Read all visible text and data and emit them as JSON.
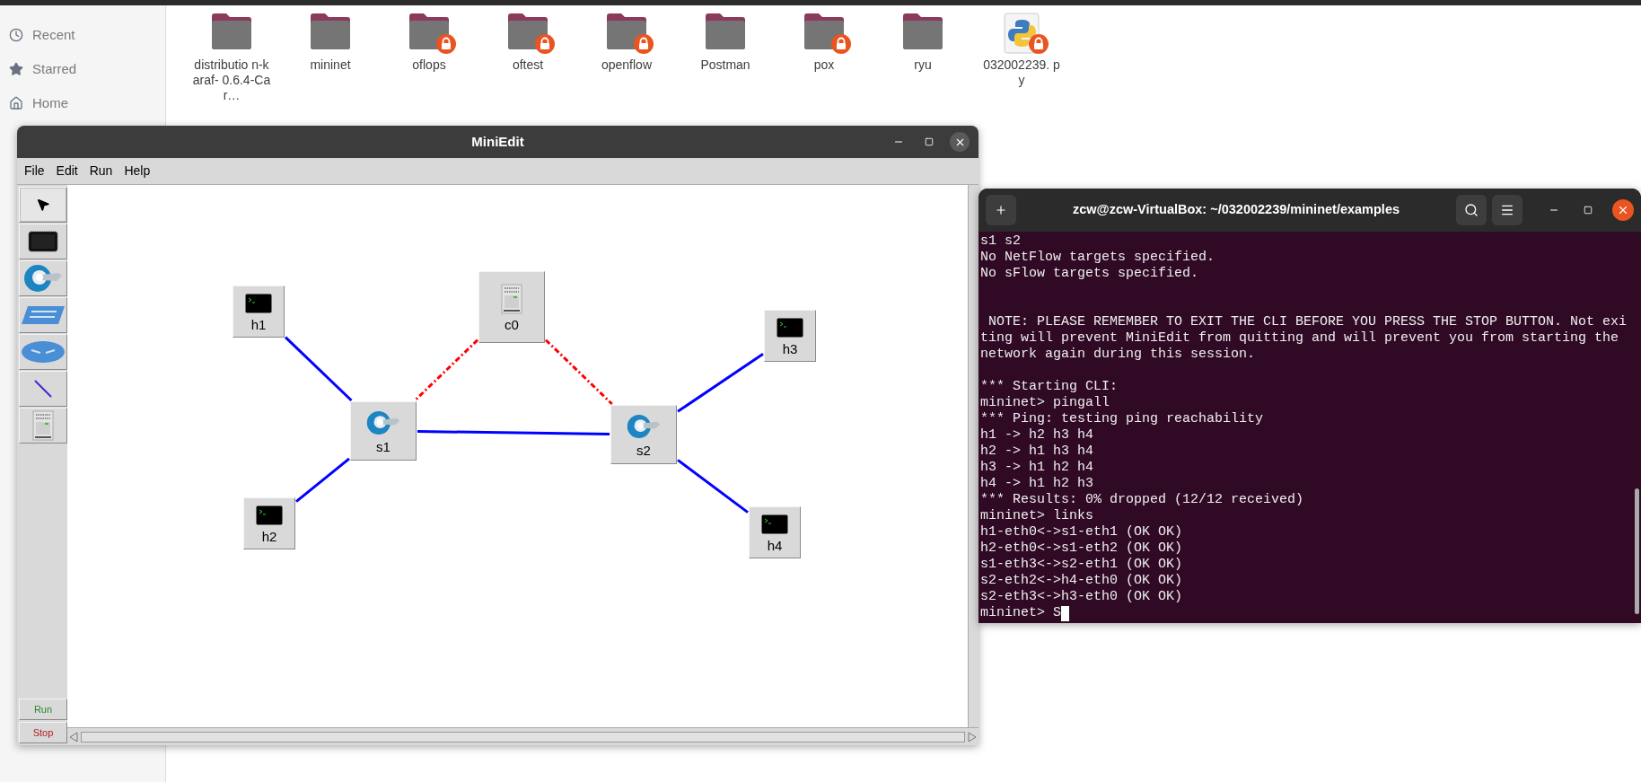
{
  "file_manager": {
    "sidebar": [
      {
        "label": "Recent",
        "kind": "clock"
      },
      {
        "label": "Starred",
        "kind": "star"
      },
      {
        "label": "Home",
        "kind": "home"
      }
    ],
    "files": [
      {
        "name": "distributio n-karaf- 0.6.4-Car…",
        "kind": "folder",
        "locked": false
      },
      {
        "name": "mininet",
        "kind": "folder",
        "locked": false
      },
      {
        "name": "oflops",
        "kind": "folder",
        "locked": true
      },
      {
        "name": "oftest",
        "kind": "folder",
        "locked": true
      },
      {
        "name": "openflow",
        "kind": "folder",
        "locked": true
      },
      {
        "name": "Postman",
        "kind": "folder",
        "locked": false
      },
      {
        "name": "pox",
        "kind": "folder",
        "locked": true
      },
      {
        "name": "ryu",
        "kind": "folder",
        "locked": false
      },
      {
        "name": "032002239. py",
        "kind": "python",
        "locked": true
      }
    ]
  },
  "miniedit": {
    "title": "MiniEdit",
    "menu": [
      "File",
      "Edit",
      "Run",
      "Help"
    ],
    "tools": [
      {
        "kind": "select",
        "selected": true
      },
      {
        "kind": "host",
        "selected": false
      },
      {
        "kind": "switch",
        "selected": false
      },
      {
        "kind": "legacy_switch",
        "selected": false
      },
      {
        "kind": "legacy_router",
        "selected": false
      },
      {
        "kind": "link",
        "selected": false
      },
      {
        "kind": "controller",
        "selected": false
      }
    ],
    "run_buttons": [
      {
        "label": "Run",
        "kind": "run"
      },
      {
        "label": "Stop",
        "kind": "stop"
      }
    ],
    "nodes": [
      {
        "label": "h1",
        "kind": "host"
      },
      {
        "label": "h2",
        "kind": "host"
      },
      {
        "label": "c0",
        "kind": "controller"
      },
      {
        "label": "h3",
        "kind": "host"
      },
      {
        "label": "h4",
        "kind": "host"
      },
      {
        "label": "s1",
        "kind": "switch"
      },
      {
        "label": "s2",
        "kind": "switch"
      }
    ],
    "links": [
      {
        "kind": "data"
      },
      {
        "kind": "data"
      },
      {
        "kind": "data"
      },
      {
        "kind": "data"
      },
      {
        "kind": "data"
      },
      {
        "kind": "control"
      },
      {
        "kind": "control"
      }
    ]
  },
  "terminal": {
    "title": "zcw@zcw-VirtualBox: ~/032002239/mininet/examples",
    "cursor": true,
    "lines": [
      {
        "kind": "text",
        "text": "s1 s2"
      },
      {
        "kind": "text",
        "text": "No NetFlow targets specified."
      },
      {
        "kind": "text",
        "text": "No sFlow targets specified."
      },
      {
        "kind": "blank"
      },
      {
        "kind": "blank"
      },
      {
        "kind": "text",
        "text": " NOTE: PLEASE REMEMBER TO EXIT THE CLI BEFORE YOU PRESS THE STOP BUTTON. Not exi"
      },
      {
        "kind": "text",
        "text": "ting will prevent MiniEdit from quitting and will prevent you from starting the"
      },
      {
        "kind": "text",
        "text": "network again during this session."
      },
      {
        "kind": "blank"
      },
      {
        "kind": "text",
        "text": "*** Starting CLI:"
      },
      {
        "kind": "text",
        "text": "mininet> pingall"
      },
      {
        "kind": "text",
        "text": "*** Ping: testing ping reachability"
      },
      {
        "kind": "text",
        "text": "h1 -> h2 h3 h4"
      },
      {
        "kind": "text",
        "text": "h2 -> h1 h3 h4"
      },
      {
        "kind": "text",
        "text": "h3 -> h1 h2 h4"
      },
      {
        "kind": "text",
        "text": "h4 -> h1 h2 h3"
      },
      {
        "kind": "text",
        "text": "*** Results: 0% dropped (12/12 received)"
      },
      {
        "kind": "text",
        "text": "mininet> links"
      },
      {
        "kind": "text",
        "text": "h1-eth0<->s1-eth1 (OK OK)"
      },
      {
        "kind": "text",
        "text": "h2-eth0<->s1-eth2 (OK OK)"
      },
      {
        "kind": "text",
        "text": "s1-eth3<->s2-eth1 (OK OK)"
      },
      {
        "kind": "text",
        "text": "s2-eth2<->h4-eth0 (OK OK)"
      },
      {
        "kind": "text",
        "text": "s2-eth3<->h3-eth0 (OK OK)"
      },
      {
        "kind": "text",
        "text": "mininet> S"
      }
    ]
  }
}
